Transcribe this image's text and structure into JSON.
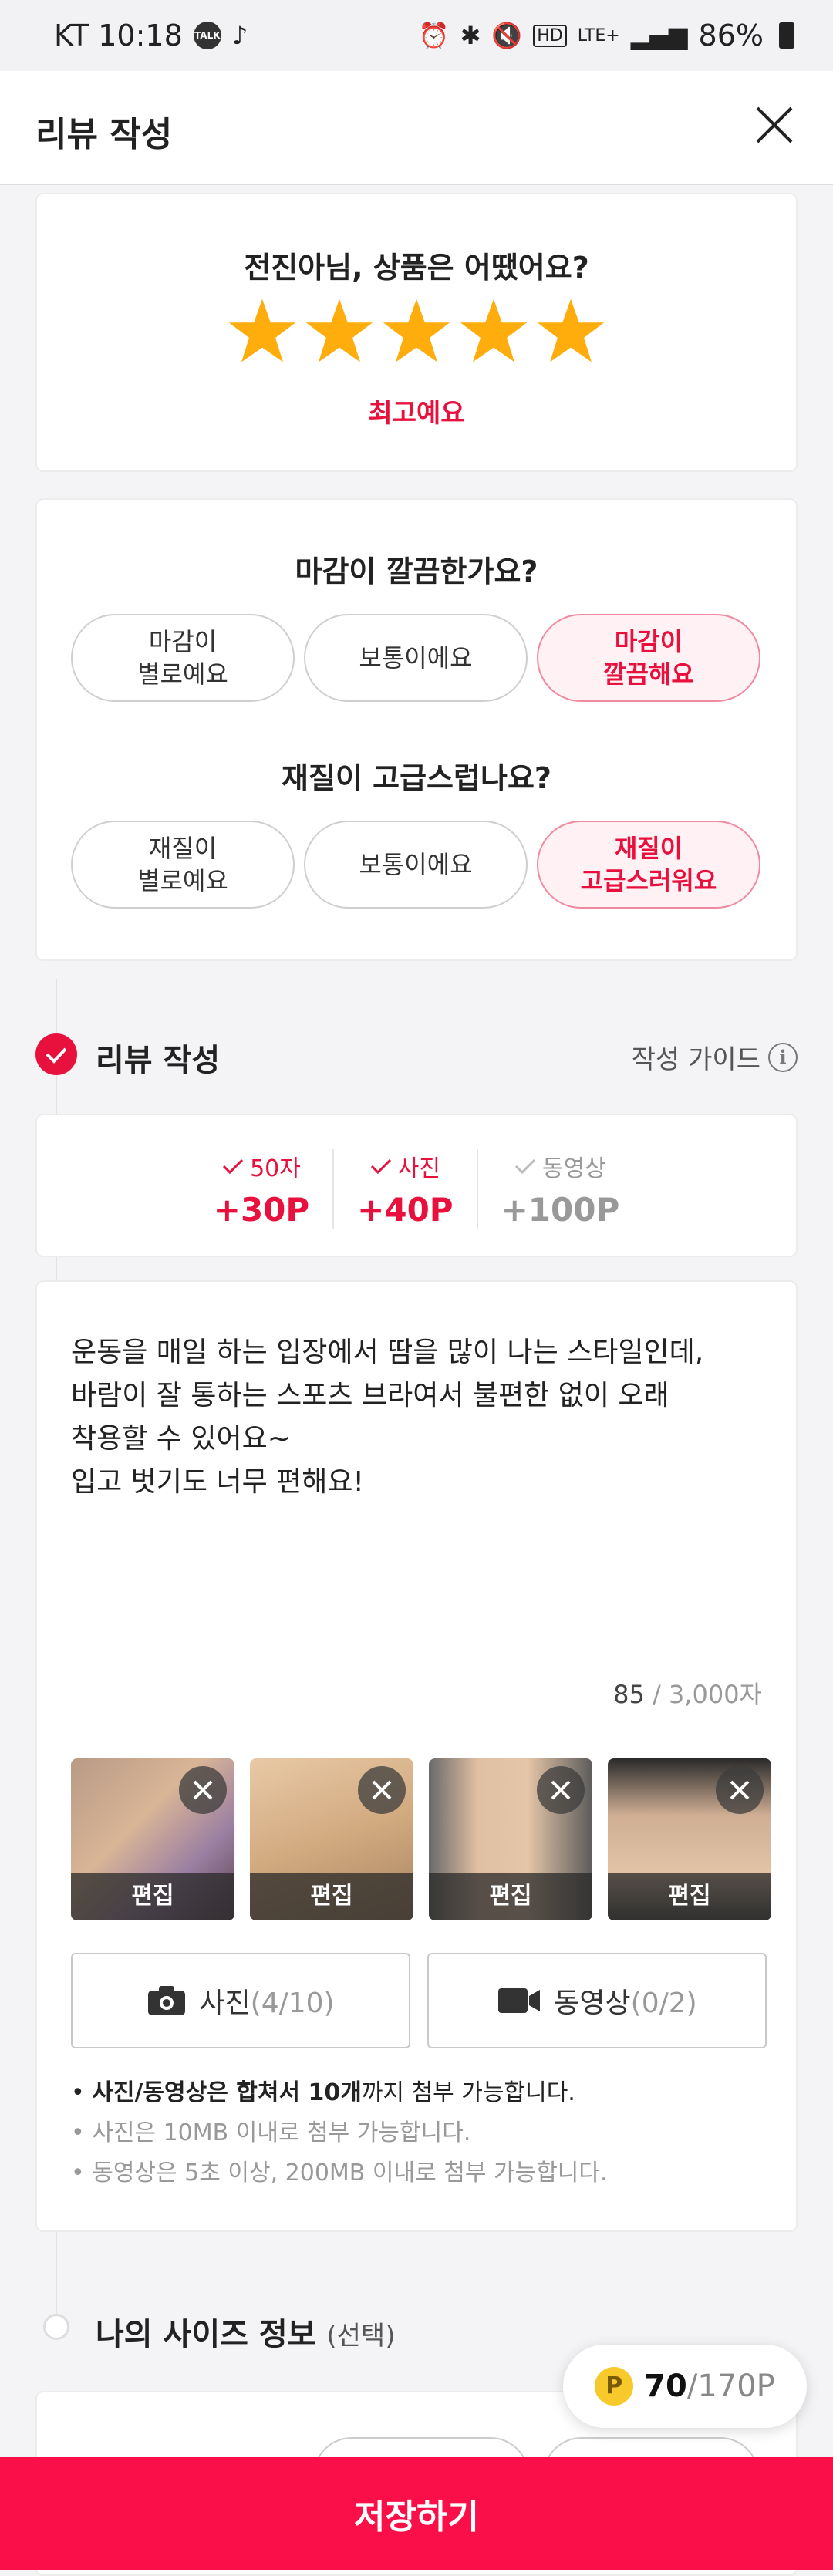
{
  "status_bar": {
    "carrier_time": "KT 10:18",
    "battery": "86%",
    "network": "LTE+"
  },
  "header": {
    "title": "리뷰 작성"
  },
  "rating": {
    "question": "전진아님, 상품은 어땠어요?",
    "stars": 5,
    "label": "최고예요"
  },
  "survey": [
    {
      "question": "마감이 깔끔한가요?",
      "options": [
        "마감이\n별로예요",
        "보통이에요",
        "마감이\n깔끔해요"
      ],
      "selected": 2
    },
    {
      "question": "재질이 고급스럽나요?",
      "options": [
        "재질이\n별로예요",
        "보통이에요",
        "재질이\n고급스러워요"
      ],
      "selected": 2
    }
  ],
  "review_section": {
    "title": "리뷰 작성",
    "guide": "작성 가이드"
  },
  "rewards": [
    {
      "label": "50자",
      "points": "+30P",
      "achieved": true
    },
    {
      "label": "사진",
      "points": "+40P",
      "achieved": true
    },
    {
      "label": "동영상",
      "points": "+100P",
      "achieved": false
    }
  ],
  "review": {
    "text": "운동을 매일 하는 입장에서 땀을 많이 나는 스타일인데,\n바람이 잘 통하는 스포츠 브라여서 불편한 없이 오래\n착용할 수 있어요~\n입고 벗기도 너무 편해요!",
    "count": "85",
    "max": " / 3,000자"
  },
  "photos": [
    {
      "edit_label": "편집"
    },
    {
      "edit_label": "편집"
    },
    {
      "edit_label": "편집"
    },
    {
      "edit_label": "편집"
    }
  ],
  "media": {
    "photo_label": "사진",
    "photo_count": "(4/10)",
    "video_label": "동영상",
    "video_count": "(0/2)"
  },
  "notes": {
    "line1_bold1": "사진/동영상은 합쳐서 10개",
    "line1_rest": "까지 첨부 가능합니다.",
    "line2": "사진은 10MB 이내로 첨부 가능합니다.",
    "line3": "동영상은 5초 이상, 200MB 이내로 첨부 가능합니다."
  },
  "size_section": {
    "title": "나의 사이즈 정보",
    "optional": "(선택)"
  },
  "points": {
    "current": "70",
    "max": "/170P"
  },
  "save_button": "저장하기",
  "colors": {
    "accent": "#e8103d",
    "save": "#fb0f48",
    "star": "#ffad0d"
  }
}
